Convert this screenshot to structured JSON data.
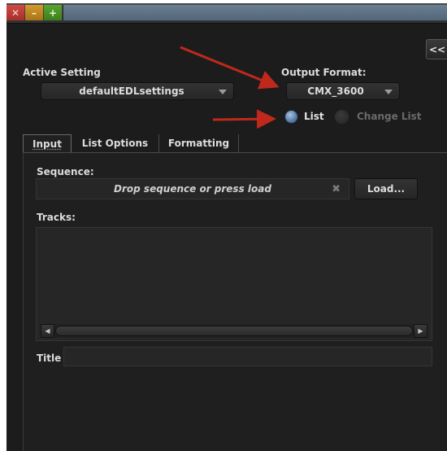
{
  "titlebar": {
    "close_glyph": "✕",
    "minimize_glyph": "–",
    "maximize_glyph": "+"
  },
  "collapse_label": "<<",
  "active_setting": {
    "label": "Active Setting",
    "value": "defaultEDLsettings"
  },
  "output_format": {
    "label": "Output Format:",
    "value": "CMX_3600"
  },
  "list_mode": {
    "options": [
      {
        "label": "List",
        "selected": true
      },
      {
        "label": "Change List",
        "selected": false
      }
    ]
  },
  "tabs": [
    {
      "label": "Input",
      "active": true
    },
    {
      "label": "List Options",
      "active": false
    },
    {
      "label": "Formatting",
      "active": false
    }
  ],
  "input_panel": {
    "sequence_label": "Sequence:",
    "sequence_placeholder": "Drop sequence or press load",
    "clear_glyph": "✖",
    "load_button": "Load...",
    "tracks_label": "Tracks:",
    "scroll_left_glyph": "◀",
    "scroll_right_glyph": "▶",
    "title_label": "Title",
    "title_value": ""
  },
  "colors": {
    "window_bg": "#1c1c1c",
    "panel_bg": "#1f1f1f",
    "accent_radio": "#5d7fa8",
    "annotation_arrow": "#c0281c"
  }
}
